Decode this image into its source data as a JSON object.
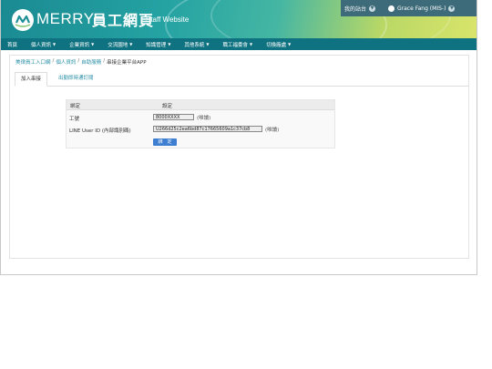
{
  "header": {
    "brand": "MERRY",
    "title_cn": "員工網頁",
    "title_en": "Staff Website",
    "my_site": "我的站台",
    "user": "Grace Fang (MIS-)"
  },
  "nav": [
    {
      "label": "首頁",
      "caret": false
    },
    {
      "label": "個人資訊",
      "caret": true
    },
    {
      "label": "企業資訊",
      "caret": true
    },
    {
      "label": "交流園地",
      "caret": true
    },
    {
      "label": "知識管理",
      "caret": true
    },
    {
      "label": "其他系統",
      "caret": true
    },
    {
      "label": "職工福委會",
      "caret": true
    },
    {
      "label": "切換廠處",
      "caret": true
    }
  ],
  "breadcrumb": {
    "crumb1": "美律員工入口網",
    "crumb2": "個人資訊",
    "crumb3": "自助服務",
    "current": "串接企業平台APP",
    "sep": "/"
  },
  "tabs": {
    "active": "加入串接",
    "inactive": "出勤即時通訂閱"
  },
  "form": {
    "col1": "綁定",
    "col2": "設定",
    "emp_label": "工號",
    "emp_value": "8000XXXX",
    "emp_note": "(唯讀)",
    "line_label": "LINE User ID (內部識別碼)",
    "line_value": "U266d25c2ea6bd87c17665609a1c37cb8",
    "line_note": "(唯讀)",
    "submit": "綁　定"
  },
  "icons": {
    "logo": "merry-logo-icon",
    "caret": "caret-down-icon"
  },
  "colors": {
    "navbar": "#0f7281",
    "topbar": "#3e6b7a",
    "link": "#2a8fa6",
    "button": "#3f7fd1"
  }
}
